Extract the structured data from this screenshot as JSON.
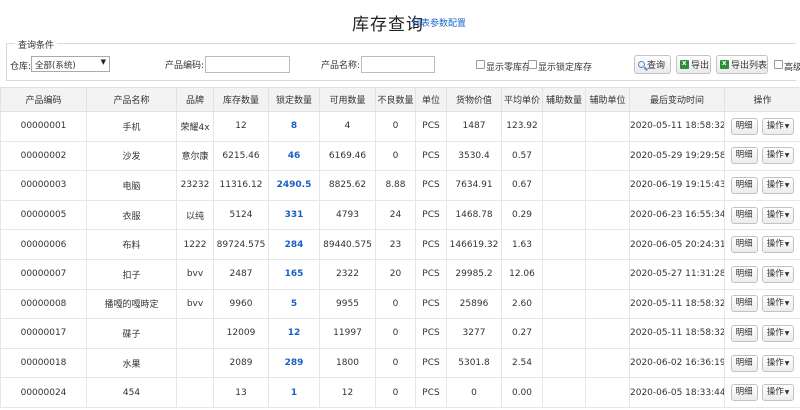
{
  "header": {
    "title": "库存查询",
    "config_link": "列表参数配置"
  },
  "query": {
    "legend": "查询条件",
    "warehouse_label": "仓库:",
    "warehouse_value": "全部(系统)",
    "product_code_label": "产品编码:",
    "product_code_value": "",
    "product_name_label": "产品名称:",
    "product_name_value": "",
    "show_zero_label": "显示零库存",
    "show_locked_label": "显示锁定库存",
    "search_button": "查询",
    "export_button": "导出",
    "export_list_button": "导出列表",
    "advanced_label": "高级"
  },
  "table": {
    "columns": [
      "产品编码",
      "产品名称",
      "品牌",
      "库存数量",
      "锁定数量",
      "可用数量",
      "不良数量",
      "单位",
      "货物价值",
      "平均单价",
      "辅助数量",
      "辅助单位",
      "最后变动时间",
      "操作"
    ],
    "detail_button": "明细",
    "action_button": "操作",
    "rows": [
      {
        "code": "00000001",
        "name": "手机",
        "brand": "荣耀4x",
        "stock": "12",
        "locked": "8",
        "available": "4",
        "bad": "0",
        "unit": "PCS",
        "value": "1487",
        "avg": "123.92",
        "aux_qty": "",
        "aux_unit": "",
        "time": "2020-05-11 18:58:32"
      },
      {
        "code": "00000002",
        "name": "沙发",
        "brand": "意尔康",
        "stock": "6215.46",
        "locked": "46",
        "available": "6169.46",
        "bad": "0",
        "unit": "PCS",
        "value": "3530.4",
        "avg": "0.57",
        "aux_qty": "",
        "aux_unit": "",
        "time": "2020-05-29 19:29:58"
      },
      {
        "code": "00000003",
        "name": "电脑",
        "brand": "23232",
        "stock": "11316.12",
        "locked": "2490.5",
        "available": "8825.62",
        "bad": "8.88",
        "unit": "PCS",
        "value": "7634.91",
        "avg": "0.67",
        "aux_qty": "",
        "aux_unit": "",
        "time": "2020-06-19 19:15:43"
      },
      {
        "code": "00000005",
        "name": "衣服",
        "brand": "以纯",
        "stock": "5124",
        "locked": "331",
        "available": "4793",
        "bad": "24",
        "unit": "PCS",
        "value": "1468.78",
        "avg": "0.29",
        "aux_qty": "",
        "aux_unit": "",
        "time": "2020-06-23 16:55:34"
      },
      {
        "code": "00000006",
        "name": "布料",
        "brand": "1222",
        "stock": "89724.575",
        "locked": "284",
        "available": "89440.575",
        "bad": "23",
        "unit": "PCS",
        "value": "146619.32",
        "avg": "1.63",
        "aux_qty": "",
        "aux_unit": "",
        "time": "2020-06-05 20:24:31"
      },
      {
        "code": "00000007",
        "name": "扣子",
        "brand": "bvv",
        "stock": "2487",
        "locked": "165",
        "available": "2322",
        "bad": "20",
        "unit": "PCS",
        "value": "29985.2",
        "avg": "12.06",
        "aux_qty": "",
        "aux_unit": "",
        "time": "2020-05-27 11:31:28"
      },
      {
        "code": "00000008",
        "name": "播嘎的嘎時定",
        "brand": "bvv",
        "stock": "9960",
        "locked": "5",
        "available": "9955",
        "bad": "0",
        "unit": "PCS",
        "value": "25896",
        "avg": "2.60",
        "aux_qty": "",
        "aux_unit": "",
        "time": "2020-05-11 18:58:32"
      },
      {
        "code": "00000017",
        "name": "碟子",
        "brand": "",
        "stock": "12009",
        "locked": "12",
        "available": "11997",
        "bad": "0",
        "unit": "PCS",
        "value": "3277",
        "avg": "0.27",
        "aux_qty": "",
        "aux_unit": "",
        "time": "2020-05-11 18:58:32"
      },
      {
        "code": "00000018",
        "name": "水果",
        "brand": "",
        "stock": "2089",
        "locked": "289",
        "available": "1800",
        "bad": "0",
        "unit": "PCS",
        "value": "5301.8",
        "avg": "2.54",
        "aux_qty": "",
        "aux_unit": "",
        "time": "2020-06-02 16:36:19"
      },
      {
        "code": "00000024",
        "name": "454",
        "brand": "",
        "stock": "13",
        "locked": "1",
        "available": "12",
        "bad": "0",
        "unit": "PCS",
        "value": "0",
        "avg": "0.00",
        "aux_qty": "",
        "aux_unit": "",
        "time": "2020-06-05 18:33:44"
      }
    ]
  },
  "colors": {
    "link": "#1a66c8",
    "locked_qty": "#1a5fc8",
    "header_bg": "#f3f3f3",
    "excel_icon": "#2f8f3a"
  }
}
